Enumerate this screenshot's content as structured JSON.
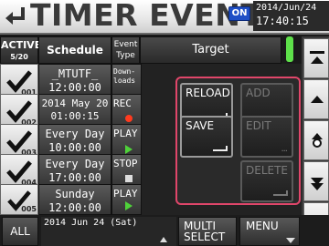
{
  "header": {
    "title": "TIMER EVENT",
    "on_badge": "ON",
    "clock_date": "2014/Jun/24",
    "clock_time": "17:40:15"
  },
  "columns": {
    "active": "ACTIVE",
    "active_count": "5/20",
    "schedule": "Schedule",
    "event_type_line1": "Event",
    "event_type_line2": "Type",
    "target": "Target"
  },
  "rows": [
    {
      "num": "001",
      "sched1": "_MTUTF_",
      "sched2": "12:00:00",
      "type1": "Down-",
      "type2": "loads",
      "indicator": "none"
    },
    {
      "num": "002",
      "sched1": "2014 May 20",
      "sched2": "01:00:15",
      "type1": "REC",
      "type2": "",
      "indicator": "rec-dot"
    },
    {
      "num": "003",
      "sched1": "Every Day",
      "sched2": "10:00:00",
      "type1": "PLAY",
      "type2": "",
      "indicator": "play"
    },
    {
      "num": "004",
      "sched1": "Every Day",
      "sched2": "17:00:00",
      "type1": "STOP",
      "type2": "",
      "indicator": "stop"
    },
    {
      "num": "005",
      "sched1": "Sunday",
      "sched2": "12:00:00",
      "type1": "PLAY",
      "type2": "",
      "indicator": "play"
    }
  ],
  "popup": {
    "reload": "RELOAD",
    "add": "ADD",
    "save": "SAVE",
    "edit": "EDIT",
    "delete": "DELETE",
    "ellipsis": "..."
  },
  "footer": {
    "all": "ALL",
    "date": "2014 Jun 24 (Sat)",
    "multi_line1": "MULTI",
    "multi_line2": "SELECT",
    "menu": "MENU"
  },
  "colors": {
    "on_badge": "#1f4fc6",
    "popup_border": "#e0466a",
    "scroll_indicator": "#5ee04a",
    "rec": "#ff3b1f",
    "play": "#4fd23a"
  },
  "icons": {
    "back": "return-arrow-icon",
    "check": "checkmark-icon",
    "scroll_top": "scroll-to-top-icon",
    "scroll_up": "scroll-up-icon",
    "scroll_position": "scroll-position-icon",
    "scroll_down": "scroll-down-icon",
    "scroll_bottom": "scroll-to-bottom-icon"
  }
}
